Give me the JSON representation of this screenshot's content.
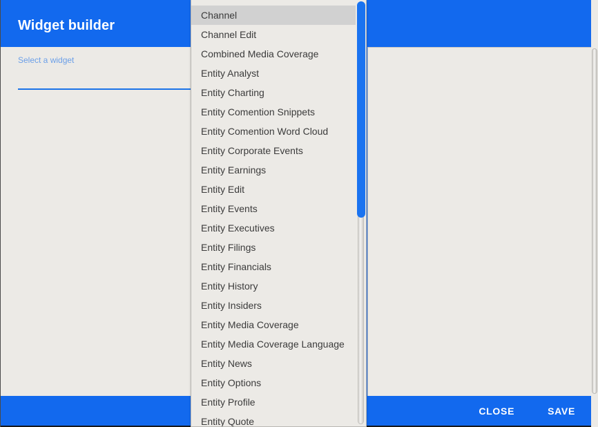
{
  "dialog": {
    "title": "Widget builder"
  },
  "select_field": {
    "label": "Select a widget",
    "value": "",
    "placeholder": ""
  },
  "dropdown": {
    "selected_index": 0,
    "items": [
      {
        "label": "Channel"
      },
      {
        "label": "Channel Edit"
      },
      {
        "label": "Combined Media Coverage"
      },
      {
        "label": "Entity Analyst"
      },
      {
        "label": "Entity Charting"
      },
      {
        "label": "Entity Comention Snippets"
      },
      {
        "label": "Entity Comention Word Cloud"
      },
      {
        "label": "Entity Corporate Events"
      },
      {
        "label": "Entity Earnings"
      },
      {
        "label": "Entity Edit"
      },
      {
        "label": "Entity Events"
      },
      {
        "label": "Entity Executives"
      },
      {
        "label": "Entity Filings"
      },
      {
        "label": "Entity Financials"
      },
      {
        "label": "Entity History"
      },
      {
        "label": "Entity Insiders"
      },
      {
        "label": "Entity Media Coverage"
      },
      {
        "label": "Entity Media Coverage Language"
      },
      {
        "label": "Entity News"
      },
      {
        "label": "Entity Options"
      },
      {
        "label": "Entity Profile"
      },
      {
        "label": "Entity Quote"
      }
    ]
  },
  "footer": {
    "close_label": "CLOSE",
    "save_label": "SAVE"
  },
  "colors": {
    "accent_blue": "#1269ee",
    "surface": "#eceae6",
    "selected_item": "#d1d1d1",
    "label_blue": "#6b9fe8",
    "underline_blue": "#1a73e8"
  }
}
